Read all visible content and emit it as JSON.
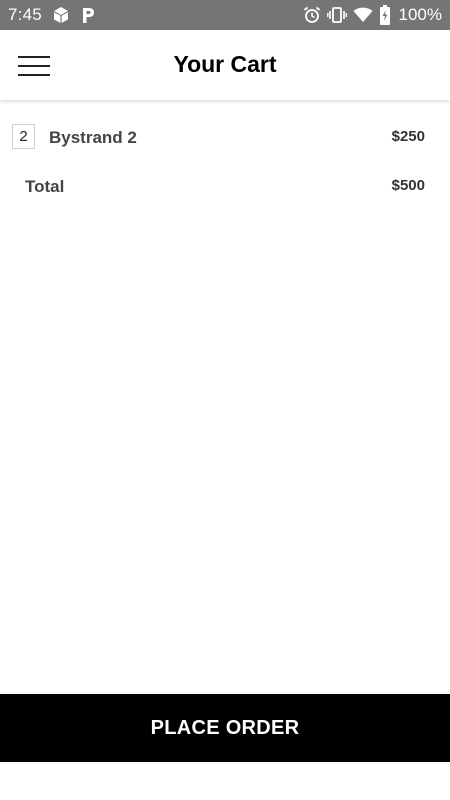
{
  "status_bar": {
    "time": "7:45",
    "battery_percent": "100%",
    "left_icons": [
      "box-icon",
      "parking-p-icon"
    ],
    "right_icons": [
      "alarm-icon",
      "vibrate-icon",
      "wifi-icon",
      "battery-charging-icon"
    ]
  },
  "header": {
    "title": "Your Cart",
    "menu_icon": "hamburger-menu-icon"
  },
  "cart": {
    "items": [
      {
        "quantity": "2",
        "name": "Bystrand 2",
        "price": "$250"
      }
    ],
    "total_label": "Total",
    "total_value": "$500"
  },
  "actions": {
    "place_order_label": "PLACE ORDER"
  },
  "colors": {
    "status_bar_bg": "#757575",
    "primary_button_bg": "#000000",
    "primary_button_text": "#ffffff"
  }
}
